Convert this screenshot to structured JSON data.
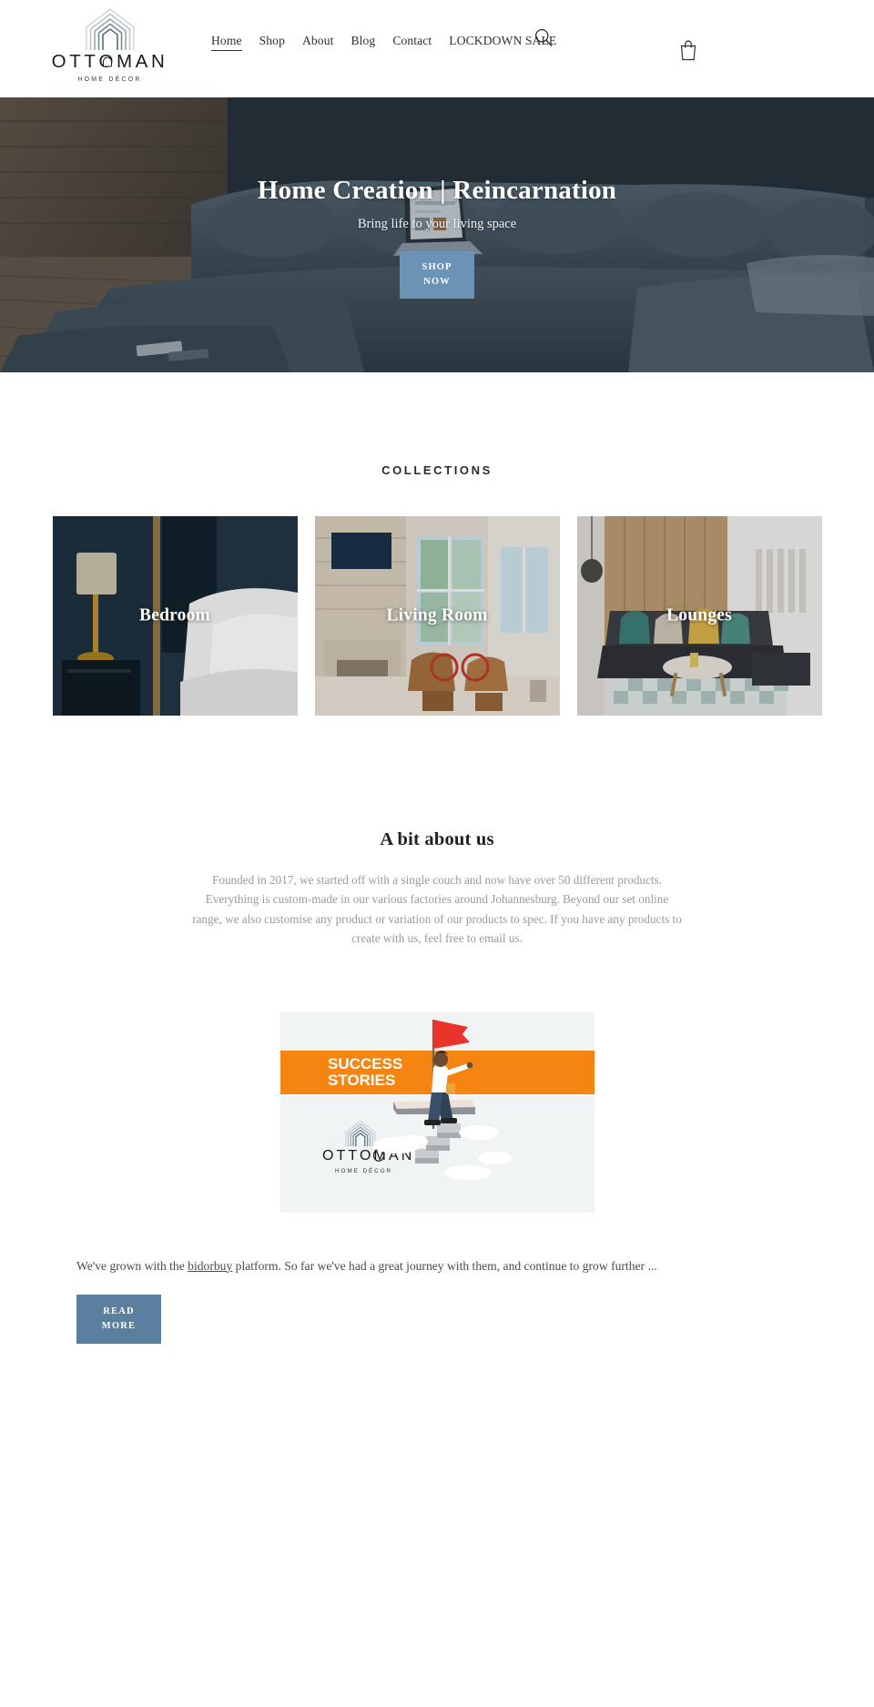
{
  "header": {
    "logo": {
      "word": "OTTOMAN",
      "word_part1": "OTT",
      "word_oglyph": "O",
      "word_part2": "MAN",
      "tagline": "HOME DÉCOR",
      "icon": "ottoman-arch-logo-icon"
    },
    "nav": [
      {
        "label": "Home",
        "active": true
      },
      {
        "label": "Shop",
        "active": false
      },
      {
        "label": "About",
        "active": false
      },
      {
        "label": "Blog",
        "active": false
      },
      {
        "label": "Contact",
        "active": false
      },
      {
        "label": "LOCKDOWN SALE",
        "active": false
      }
    ],
    "search_icon": "search-icon",
    "cart_icon": "shopping-bag-icon"
  },
  "hero": {
    "title": "Home Creation | Reincarnation",
    "subtitle": "Bring life to your living space",
    "cta_line1": "SHOP",
    "cta_line2": "NOW",
    "cta_color": "#6b93b5",
    "image_alt": "dark grey sectional couch in a wood panelled living room with a person using a laptop"
  },
  "collections": {
    "eyebrow": "COLLECTIONS",
    "cards": [
      {
        "label": "Bedroom",
        "image_alt": "dark navy bedroom with brass lamp and white bedding"
      },
      {
        "label": "Living Room",
        "image_alt": "bright living room with fireplace, leather chairs and large windows"
      },
      {
        "label": "Lounges",
        "image_alt": "lounge with dark sectional sofa, round wooden table and checkered rug"
      }
    ]
  },
  "about": {
    "title": "A bit about us",
    "body": "Founded in 2017, we started off with a single couch and now have over 50 different products. Everything is custom-made in our various factories around Johannesburg. Beyond our set online range, we also customise any product or variation of our products to spec. If you have any products to create with us, feel free to email us."
  },
  "success_story": {
    "banner_line1": "SUCCESS",
    "banner_line2": "STORIES",
    "banner_color": "#f58410",
    "logo_word": "OTTOMAN",
    "logo_tagline": "HOME DÉCOR",
    "image_alt": "illustration of a person climbing steps toward a red flag, with the Ottoman Home Decor logo and a SUCCESS STORIES banner",
    "text_before_link": "We've grown with the ",
    "link_label": "bidorbuy",
    "text_after_link": " platform. So far we've had a great journey with them, and continue to grow further ...",
    "read_more_line1": "READ",
    "read_more_line2": "MORE",
    "read_more_color": "#5b7f9e"
  }
}
